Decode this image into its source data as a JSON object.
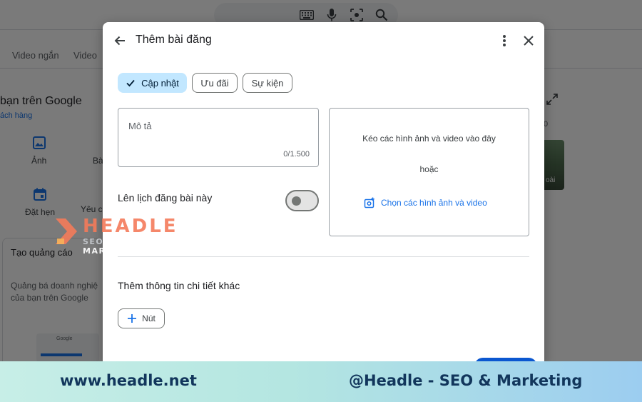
{
  "background": {
    "tabs": [
      "Video ngắn",
      "Video"
    ],
    "title": "bạn trên Google",
    "link": "ách hàng",
    "actions": [
      {
        "label": "Ảnh",
        "icon": "image-icon"
      },
      {
        "label": "Bà",
        "icon": ""
      },
      {
        "label": "Đặt hẹn",
        "icon": "calendar-icon"
      },
      {
        "label": "Yêu c",
        "icon": ""
      }
    ],
    "ad_card": {
      "title": "Tạo quảng cáo",
      "text": "Quảng bá doanh nghiệ\ncủa bạn trên Google",
      "mock_word": "Google"
    },
    "right_panel": {
      "digit": "0",
      "photo_label": "oài"
    }
  },
  "dialog": {
    "title": "Thêm bài đăng",
    "chips": [
      {
        "label": "Cập nhật",
        "selected": true
      },
      {
        "label": "Ưu đãi",
        "selected": false
      },
      {
        "label": "Sự kiện",
        "selected": false
      }
    ],
    "description": {
      "label": "Mô tả",
      "counter": "0/1.500"
    },
    "schedule": {
      "label": "Lên lịch đăng bài này",
      "enabled": false
    },
    "media": {
      "drag_text": "Kéo các hình ảnh và video vào đây",
      "or_text": "hoặc",
      "pick_text": "Chọn các hình ảnh và video"
    },
    "more_details_label": "Thêm thông tin chi tiết khác",
    "add_button_label": "Nút"
  },
  "watermark": {
    "brand": "HEADLE",
    "tagline_a": "SEO ",
    "tagline_b": "& MARKETING"
  },
  "footer": {
    "website": "www.headle.net",
    "handle": "@Headle - SEO & Marketing"
  },
  "colors": {
    "accent": "#1a73e8",
    "chip_selected": "#c2e7ff",
    "brand": "#f47b5a",
    "footer_text": "#12365c"
  }
}
